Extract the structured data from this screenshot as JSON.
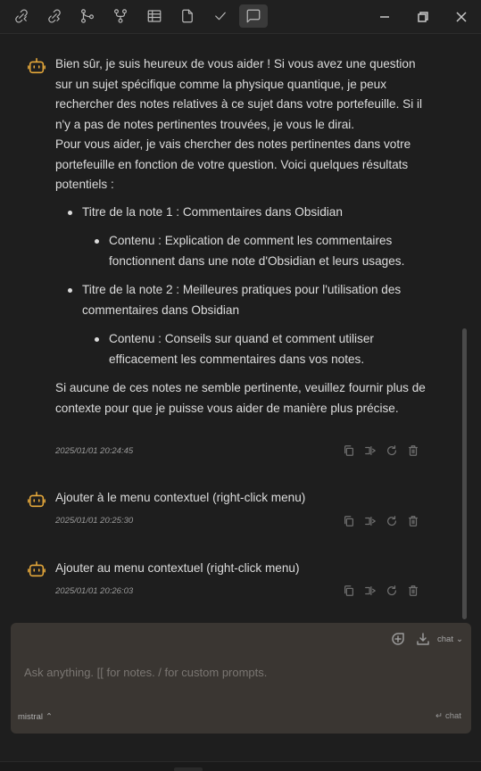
{
  "toolbar": {
    "buttons": [
      {
        "icon": "link-back-icon"
      },
      {
        "icon": "link-forward-icon"
      },
      {
        "icon": "git-merge-icon"
      },
      {
        "icon": "git-fork-icon"
      },
      {
        "icon": "table-icon"
      },
      {
        "icon": "file-icon"
      },
      {
        "icon": "check-icon"
      },
      {
        "icon": "message-square-icon",
        "active": true
      }
    ],
    "window": {
      "minimize": "minimize-icon",
      "restore": "restore-icon",
      "close": "close-icon"
    }
  },
  "messages": [
    {
      "paragraph1": "Bien sûr, je suis heureux de vous aider ! Si vous avez une question sur un sujet spécifique comme la physique quantique, je peux rechercher des notes relatives à ce sujet dans votre portefeuille. Si il n'y a pas de notes pertinentes trouvées, je vous le dirai.",
      "paragraph2": "Pour vous aider, je vais chercher des notes pertinentes dans votre portefeuille en fonction de votre question. Voici quelques résultats potentiels :",
      "list": [
        {
          "title": "Titre de la note 1 : Commentaires dans Obsidian",
          "content": "Contenu : Explication de comment les commentaires fonctionnent dans une note d'Obsidian et leurs usages."
        },
        {
          "title": "Titre de la note 2 : Meilleures pratiques pour l'utilisation des commentaires dans Obsidian",
          "content": "Contenu : Conseils sur quand et comment utiliser efficacement les commentaires dans vos notes."
        }
      ],
      "paragraph3": "Si aucune de ces notes ne semble pertinente, veuillez fournir plus de contexte pour que je puisse vous aider de manière plus précise.",
      "timestamp": "2025/01/01 20:24:45"
    },
    {
      "text": "Ajouter à le menu contextuel (right-click menu)",
      "timestamp": "2025/01/01 20:25:30"
    },
    {
      "text": "Ajouter au menu contextuel (right-click menu)",
      "timestamp": "2025/01/01 20:26:03"
    }
  ],
  "message_actions": [
    "copy-icon",
    "insert-icon",
    "regenerate-icon",
    "delete-icon"
  ],
  "composer": {
    "placeholder": "Ask anything. [[ for notes. / for custom prompts.",
    "value": "",
    "mode": "chat",
    "model": "mistral",
    "send_label": "chat",
    "icons": [
      "new-chat-icon",
      "download-icon"
    ]
  },
  "colors": {
    "background": "#1e1e1e",
    "accent_bot": "#e7a93b",
    "composer_bg": "#3a3632",
    "text": "#dcdcdc",
    "muted": "#9a9a9a"
  }
}
